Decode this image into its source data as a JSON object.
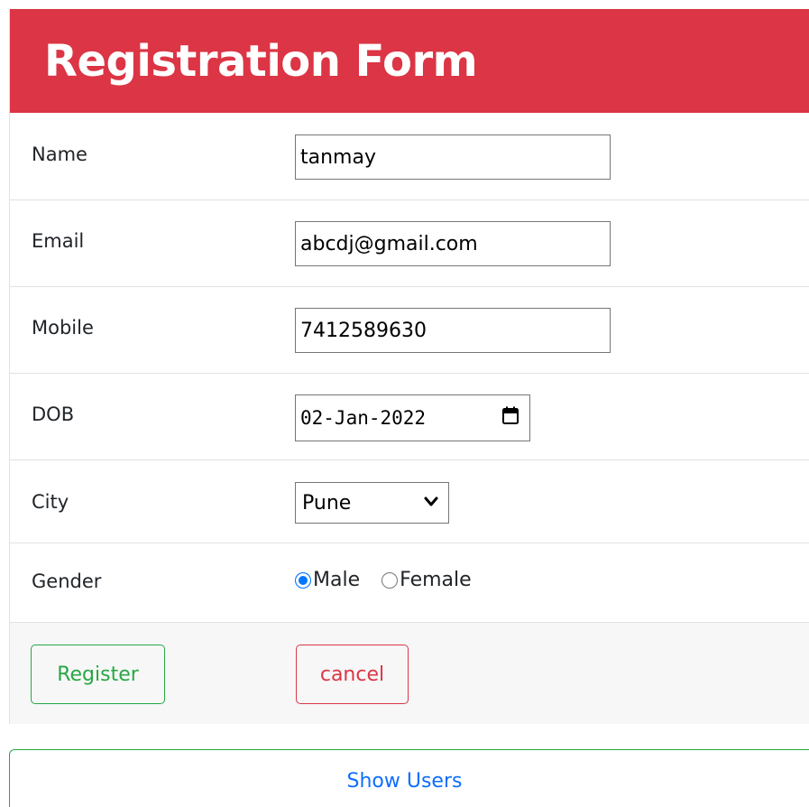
{
  "form": {
    "title": "Registration Form",
    "fields": {
      "name": {
        "label": "Name",
        "value": "tanmay"
      },
      "email": {
        "label": "Email",
        "value": "abcdj@gmail.com"
      },
      "mobile": {
        "label": "Mobile",
        "value": "7412589630"
      },
      "dob": {
        "label": "DOB",
        "value": "02-Jan-2022"
      },
      "city": {
        "label": "City",
        "value": "Pune"
      },
      "gender": {
        "label": "Gender",
        "options": [
          {
            "label": "Male",
            "checked": true
          },
          {
            "label": "Female",
            "checked": false
          }
        ]
      }
    },
    "buttons": {
      "register": "Register",
      "cancel": "cancel"
    }
  },
  "show_users_label": "Show Users",
  "colors": {
    "header_bg": "#dc3545",
    "register": "#28a745",
    "cancel": "#dc3545",
    "link": "#0d6efd",
    "radio_checked": "#0075ff"
  },
  "icons": {
    "date_picker": "calendar-icon",
    "select_arrow": "chevron-down-icon"
  }
}
